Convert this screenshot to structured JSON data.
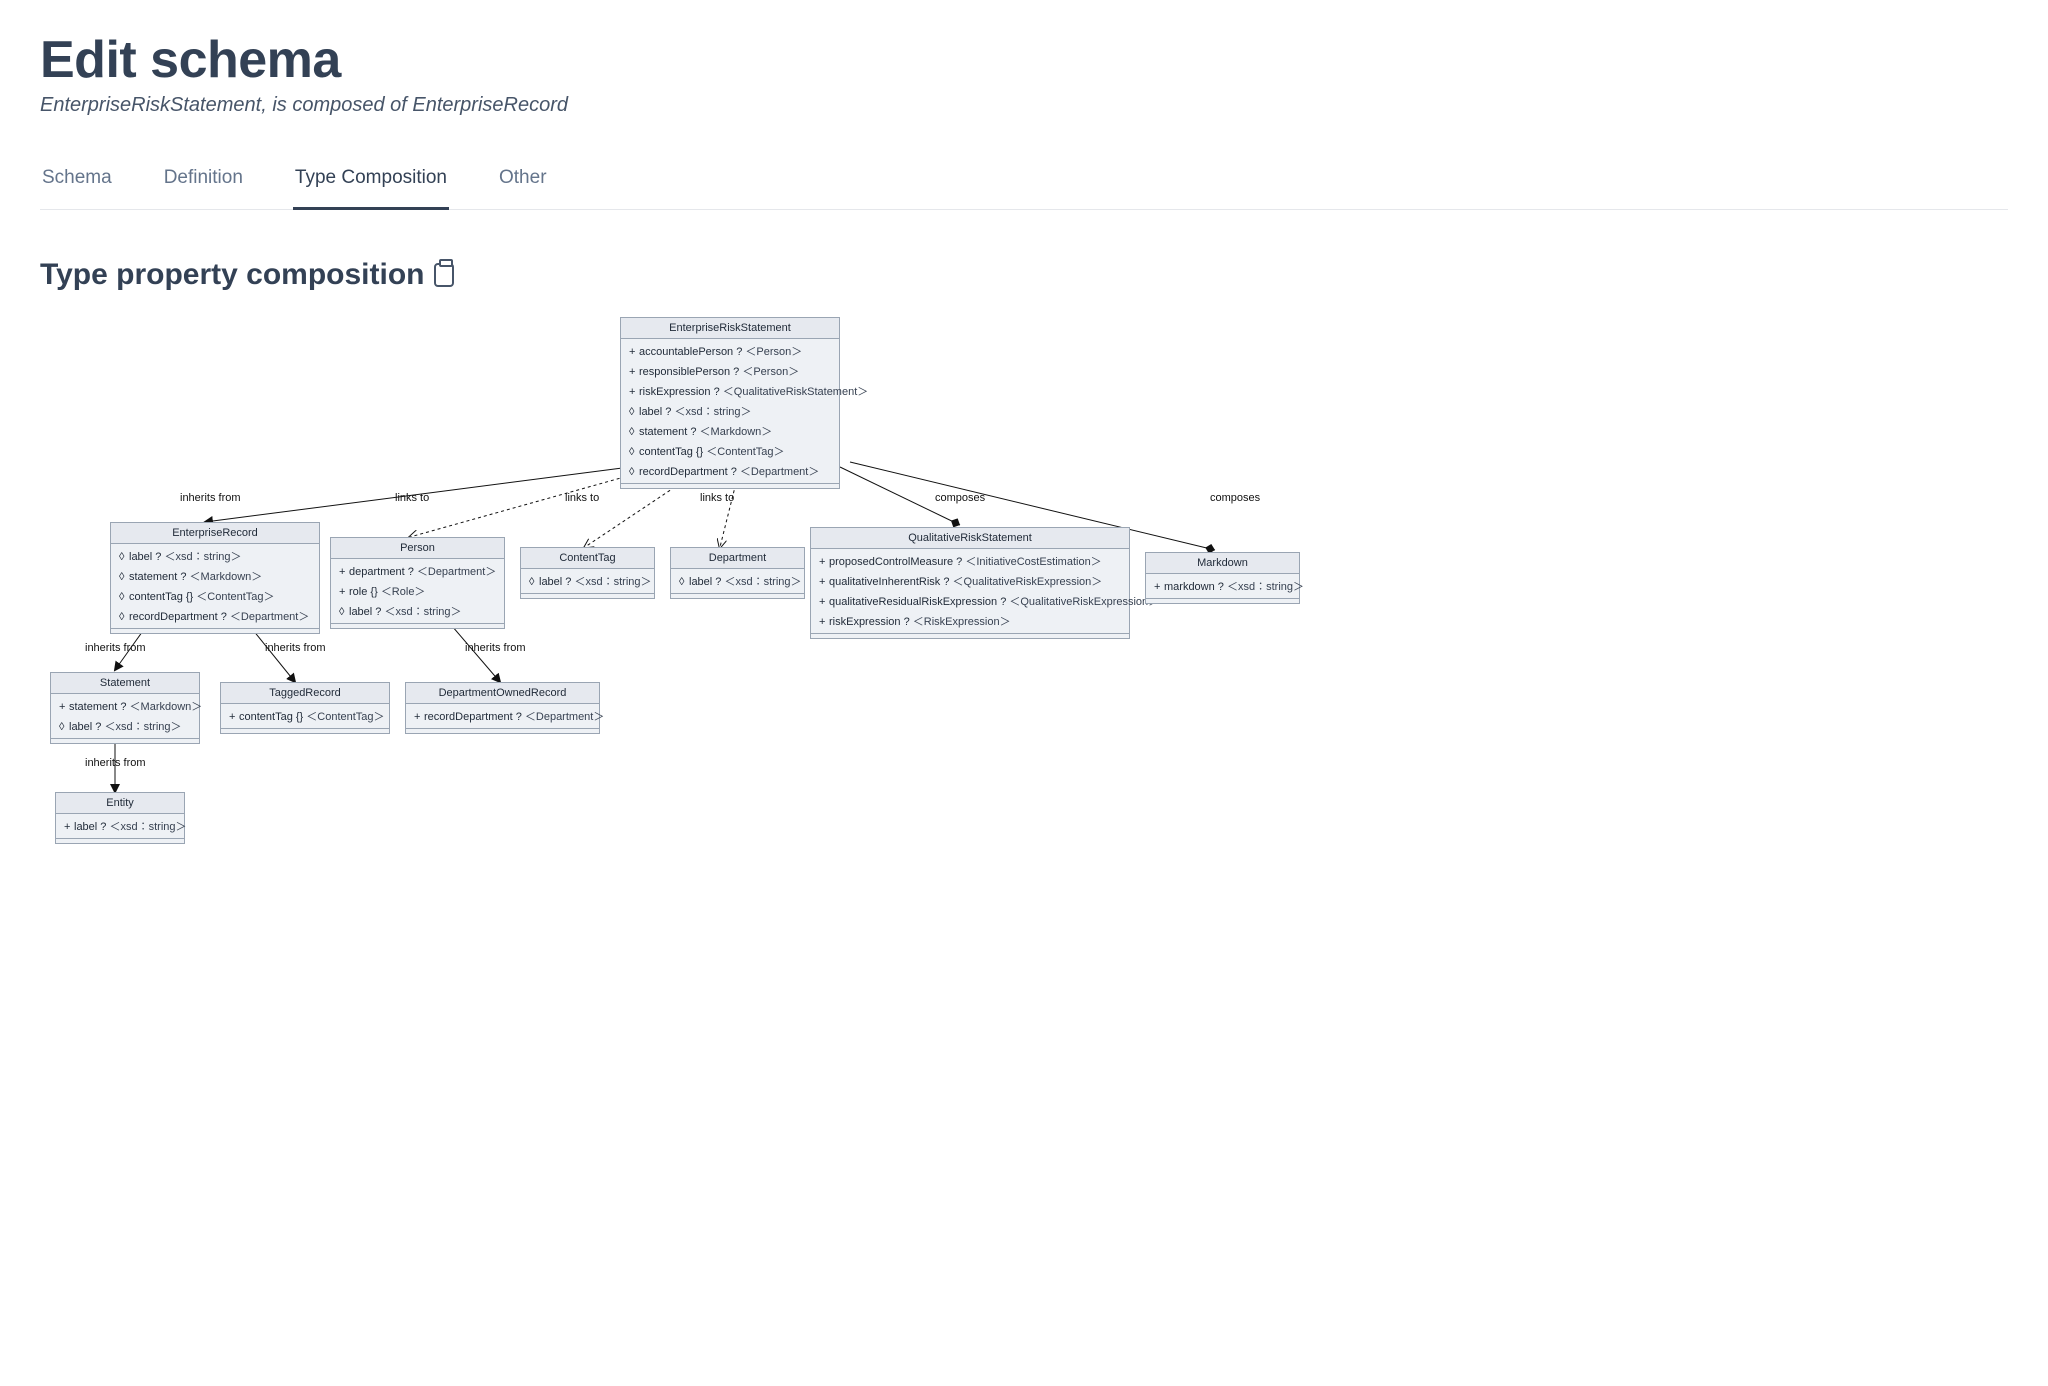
{
  "header": {
    "title": "Edit schema",
    "subtitle": "EnterpriseRiskStatement, is composed of EnterpriseRecord"
  },
  "tabs": {
    "items": [
      "Schema",
      "Definition",
      "Type Composition",
      "Other"
    ],
    "active": 2
  },
  "section": {
    "title": "Type property composition"
  },
  "edgeLabels": {
    "inherits1": "inherits from",
    "links1": "links to",
    "links2": "links to",
    "links3": "links to",
    "composes1": "composes",
    "composes2": "composes",
    "inherits2": "inherits from",
    "inherits3": "inherits from",
    "inherits4": "inherits from",
    "inherits5": "inherits from"
  },
  "boxes": {
    "EnterpriseRiskStatement": {
      "title": "EnterpriseRiskStatement",
      "rows": [
        {
          "sym": "+",
          "name": "accountablePerson",
          "card": "?",
          "type": "＜Person＞"
        },
        {
          "sym": "+",
          "name": "responsiblePerson",
          "card": "?",
          "type": "＜Person＞"
        },
        {
          "sym": "+",
          "name": "riskExpression",
          "card": "?",
          "type": "＜QualitativeRiskStatement＞"
        },
        {
          "sym": "◊",
          "name": "label",
          "card": "?",
          "type": "＜xsd∶string＞"
        },
        {
          "sym": "◊",
          "name": "statement",
          "card": "?",
          "type": "＜Markdown＞"
        },
        {
          "sym": "◊",
          "name": "contentTag",
          "card": "{}",
          "type": "＜ContentTag＞"
        },
        {
          "sym": "◊",
          "name": "recordDepartment",
          "card": "?",
          "type": "＜Department＞"
        }
      ]
    },
    "EnterpriseRecord": {
      "title": "EnterpriseRecord",
      "rows": [
        {
          "sym": "◊",
          "name": "label",
          "card": "?",
          "type": "＜xsd∶string＞"
        },
        {
          "sym": "◊",
          "name": "statement",
          "card": "?",
          "type": "＜Markdown＞"
        },
        {
          "sym": "◊",
          "name": "contentTag",
          "card": "{}",
          "type": "＜ContentTag＞"
        },
        {
          "sym": "◊",
          "name": "recordDepartment",
          "card": "?",
          "type": "＜Department＞"
        }
      ]
    },
    "Person": {
      "title": "Person",
      "rows": [
        {
          "sym": "+",
          "name": "department",
          "card": "?",
          "type": "＜Department＞"
        },
        {
          "sym": "+",
          "name": "role",
          "card": "{}",
          "type": "＜Role＞"
        },
        {
          "sym": "◊",
          "name": "label",
          "card": "?",
          "type": "＜xsd∶string＞"
        }
      ]
    },
    "ContentTag": {
      "title": "ContentTag",
      "rows": [
        {
          "sym": "◊",
          "name": "label",
          "card": "?",
          "type": "＜xsd∶string＞"
        }
      ]
    },
    "Department": {
      "title": "Department",
      "rows": [
        {
          "sym": "◊",
          "name": "label",
          "card": "?",
          "type": "＜xsd∶string＞"
        }
      ]
    },
    "QualitativeRiskStatement": {
      "title": "QualitativeRiskStatement",
      "rows": [
        {
          "sym": "+",
          "name": "proposedControlMeasure",
          "card": "?",
          "type": "＜InitiativeCostEstimation＞"
        },
        {
          "sym": "+",
          "name": "qualitativeInherentRisk",
          "card": "?",
          "type": "＜QualitativeRiskExpression＞"
        },
        {
          "sym": "+",
          "name": "qualitativeResidualRiskExpression",
          "card": "?",
          "type": "＜QualitativeRiskExpression＞"
        },
        {
          "sym": "+",
          "name": "riskExpression",
          "card": "?",
          "type": "＜RiskExpression＞"
        }
      ]
    },
    "Markdown": {
      "title": "Markdown",
      "rows": [
        {
          "sym": "+",
          "name": "markdown",
          "card": "?",
          "type": "＜xsd∶string＞"
        }
      ]
    },
    "Statement": {
      "title": "Statement",
      "rows": [
        {
          "sym": "+",
          "name": "statement",
          "card": "?",
          "type": "＜Markdown＞"
        },
        {
          "sym": "◊",
          "name": "label",
          "card": "?",
          "type": "＜xsd∶string＞"
        }
      ]
    },
    "TaggedRecord": {
      "title": "TaggedRecord",
      "rows": [
        {
          "sym": "+",
          "name": "contentTag",
          "card": "{}",
          "type": "＜ContentTag＞"
        }
      ]
    },
    "DepartmentOwnedRecord": {
      "title": "DepartmentOwnedRecord",
      "rows": [
        {
          "sym": "+",
          "name": "recordDepartment",
          "card": "?",
          "type": "＜Department＞"
        }
      ]
    },
    "Entity": {
      "title": "Entity",
      "rows": [
        {
          "sym": "+",
          "name": "label",
          "card": "?",
          "type": "＜xsd∶string＞"
        }
      ]
    }
  }
}
